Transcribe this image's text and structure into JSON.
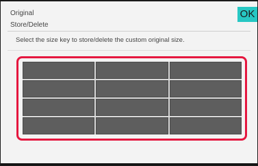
{
  "header": {
    "title_line1": "Original",
    "title_line2": "Store/Delete",
    "ok_label": "OK"
  },
  "instruction": "Select the size key to store/delete the custom original size.",
  "size_keys": {
    "rows": 4,
    "columns": 3,
    "labels": [
      "",
      "",
      "",
      "",
      "",
      "",
      "",
      "",
      "",
      "",
      "",
      ""
    ]
  },
  "colors": {
    "accent_ok": "#27c7c3",
    "highlight_frame": "#e5173f",
    "key_fill": "#5e5e5e"
  }
}
